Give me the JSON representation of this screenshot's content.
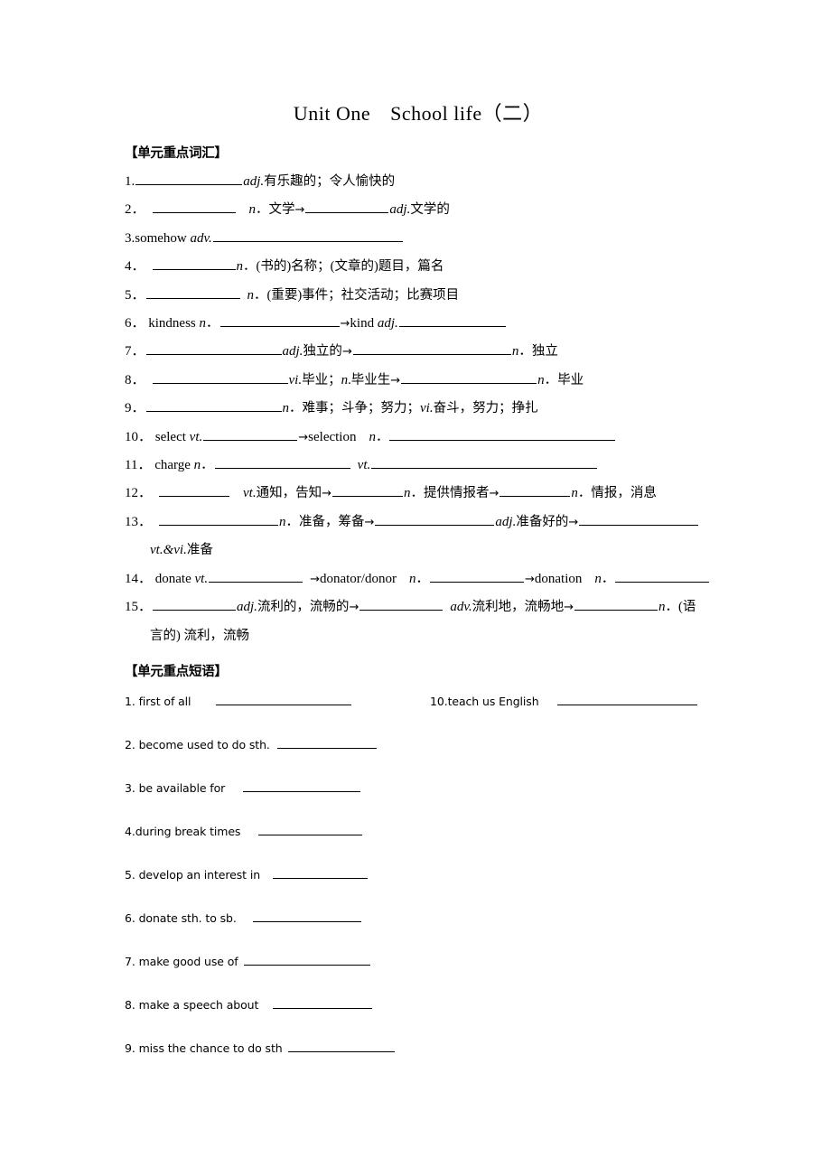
{
  "document": {
    "title_main": "Unit One",
    "title_sub": "School life",
    "title_paren": "（二）"
  },
  "vocab_section": {
    "heading": "【单元重点词汇】",
    "items": [
      {
        "num": "1.",
        "parts": [
          {
            "t": "blank",
            "w": "b-l"
          },
          {
            "t": "it",
            "v": "adj."
          },
          {
            "t": "cjk",
            "v": "有乐趣的；令人愉快的"
          }
        ]
      },
      {
        "num": "2．",
        "parts": [
          {
            "t": "gap",
            "v": "s"
          },
          {
            "t": "blank",
            "w": "b-m"
          },
          {
            "t": "gap",
            "v": "m"
          },
          {
            "t": "it",
            "v": "n"
          },
          {
            "t": "cjk",
            "v": "．文学"
          },
          {
            "t": "arrow",
            "v": "→"
          },
          {
            "t": "blank",
            "w": "b-m"
          },
          {
            "t": "it",
            "v": "adj."
          },
          {
            "t": "cjk",
            "v": "文学的"
          }
        ]
      },
      {
        "num": "3.somehow",
        "parts": [
          {
            "t": "sp"
          },
          {
            "t": "it",
            "v": "adv."
          },
          {
            "t": "blank",
            "w": "b-w2"
          }
        ]
      },
      {
        "num": "4．",
        "parts": [
          {
            "t": "gap",
            "v": "s"
          },
          {
            "t": "blank",
            "w": "b-m"
          },
          {
            "t": "it",
            "v": "n"
          },
          {
            "t": "cjk",
            "v": "．(书的)名称；(文章的)题目，篇名"
          }
        ]
      },
      {
        "num": "5．",
        "parts": [
          {
            "t": "blank",
            "w": "b-ml"
          },
          {
            "t": "gap",
            "v": "s"
          },
          {
            "t": "it",
            "v": "n"
          },
          {
            "t": "cjk",
            "v": "．(重要)事件；社交活动；比赛项目"
          }
        ]
      },
      {
        "num": "6．",
        "parts": [
          {
            "t": "sp"
          },
          {
            "t": "txt",
            "v": "kindness"
          },
          {
            "t": "sp"
          },
          {
            "t": "it",
            "v": "n"
          },
          {
            "t": "cjk",
            "v": "．"
          },
          {
            "t": "blank",
            "w": "b-xl"
          },
          {
            "t": "arrow",
            "v": "→"
          },
          {
            "t": "txt",
            "v": "kind"
          },
          {
            "t": "sp"
          },
          {
            "t": "it",
            "v": "adj."
          },
          {
            "t": "blank",
            "w": "b-l"
          }
        ]
      },
      {
        "num": "7．",
        "parts": [
          {
            "t": "blank",
            "w": "b-xxl"
          },
          {
            "t": "it",
            "v": "adj."
          },
          {
            "t": "cjk",
            "v": "独立的"
          },
          {
            "t": "arrow",
            "v": "→"
          },
          {
            "t": "blank",
            "w": "b-w1"
          },
          {
            "t": "it",
            "v": "n"
          },
          {
            "t": "cjk",
            "v": "．独立"
          }
        ]
      },
      {
        "num": "8．",
        "parts": [
          {
            "t": "gap",
            "v": "s"
          },
          {
            "t": "blank",
            "w": "b-xxl"
          },
          {
            "t": "it",
            "v": "vi."
          },
          {
            "t": "cjk",
            "v": "毕业；"
          },
          {
            "t": "it",
            "v": "n"
          },
          {
            "t": "cjk",
            "v": ".毕业生"
          },
          {
            "t": "arrow",
            "v": "→"
          },
          {
            "t": "blank",
            "w": "b-xxl"
          },
          {
            "t": "it",
            "v": "n"
          },
          {
            "t": "cjk",
            "v": "．毕业"
          }
        ]
      },
      {
        "num": "9．",
        "parts": [
          {
            "t": "blank",
            "w": "b-xxl"
          },
          {
            "t": "it",
            "v": "n"
          },
          {
            "t": "cjk",
            "v": "．难事；斗争；努力；"
          },
          {
            "t": "it",
            "v": "vi."
          },
          {
            "t": "cjk",
            "v": "奋斗，努力；挣扎"
          }
        ]
      },
      {
        "num": "10．",
        "parts": [
          {
            "t": "sp"
          },
          {
            "t": "txt",
            "v": "select"
          },
          {
            "t": "sp"
          },
          {
            "t": "it",
            "v": "vt."
          },
          {
            "t": "blank",
            "w": "b-ml"
          },
          {
            "t": "arrow",
            "v": "→"
          },
          {
            "t": "txt",
            "v": "selection"
          },
          {
            "t": "gap",
            "v": "m"
          },
          {
            "t": "it",
            "v": "n"
          },
          {
            "t": "cjk",
            "v": "．"
          },
          {
            "t": "blank",
            "w": "b-w3"
          }
        ]
      },
      {
        "num": "11．",
        "parts": [
          {
            "t": "sp"
          },
          {
            "t": "txt",
            "v": "charge"
          },
          {
            "t": "sp"
          },
          {
            "t": "it",
            "v": "n"
          },
          {
            "t": "cjk",
            "v": "．"
          },
          {
            "t": "blank",
            "w": "b-xxl"
          },
          {
            "t": "gap",
            "v": "s"
          },
          {
            "t": "it",
            "v": "vt."
          },
          {
            "t": "blank",
            "w": "b-w3"
          }
        ]
      },
      {
        "num": "12．",
        "parts": [
          {
            "t": "gap",
            "v": "s"
          },
          {
            "t": "blank",
            "w": "b-s"
          },
          {
            "t": "gap",
            "v": "m"
          },
          {
            "t": "it",
            "v": "vt."
          },
          {
            "t": "cjk",
            "v": "通知，告知"
          },
          {
            "t": "arrow",
            "v": "→"
          },
          {
            "t": "blank",
            "w": "b-s"
          },
          {
            "t": "it",
            "v": "n"
          },
          {
            "t": "cjk",
            "v": "．提供情报者"
          },
          {
            "t": "arrow",
            "v": "→"
          },
          {
            "t": "blank",
            "w": "b-s"
          },
          {
            "t": "it",
            "v": "n"
          },
          {
            "t": "cjk",
            "v": "．情报，消息"
          }
        ]
      },
      {
        "num": "13．",
        "parts": [
          {
            "t": "gap",
            "v": "s"
          },
          {
            "t": "blank",
            "w": "b-xl"
          },
          {
            "t": "it",
            "v": "n"
          },
          {
            "t": "cjk",
            "v": "．准备，筹备"
          },
          {
            "t": "arrow",
            "v": "→"
          },
          {
            "t": "blank",
            "w": "b-xl"
          },
          {
            "t": "it",
            "v": "adj."
          },
          {
            "t": "cjk",
            "v": "准备好的"
          },
          {
            "t": "arrow",
            "v": "→"
          },
          {
            "t": "blank",
            "w": "b-xl"
          }
        ],
        "cont": [
          {
            "t": "it",
            "v": "vt.&vi."
          },
          {
            "t": "cjk",
            "v": "准备"
          }
        ]
      },
      {
        "num": "14．",
        "parts": [
          {
            "t": "sp"
          },
          {
            "t": "txt",
            "v": "donate"
          },
          {
            "t": "sp"
          },
          {
            "t": "it",
            "v": "vt."
          },
          {
            "t": "blank",
            "w": "b-ml"
          },
          {
            "t": "gap",
            "v": "s"
          },
          {
            "t": "arrow",
            "v": "→"
          },
          {
            "t": "txt",
            "v": "donator/donor"
          },
          {
            "t": "gap",
            "v": "m"
          },
          {
            "t": "it",
            "v": "n"
          },
          {
            "t": "cjk",
            "v": "．"
          },
          {
            "t": "blank",
            "w": "b-ml"
          },
          {
            "t": "arrow",
            "v": "→"
          },
          {
            "t": "txt",
            "v": "donation"
          },
          {
            "t": "gap",
            "v": "m"
          },
          {
            "t": "it",
            "v": "n"
          },
          {
            "t": "cjk",
            "v": "．"
          },
          {
            "t": "blank",
            "w": "b-ml"
          }
        ]
      },
      {
        "num": "15．",
        "parts": [
          {
            "t": "blank",
            "w": "b-m"
          },
          {
            "t": "it",
            "v": "adj."
          },
          {
            "t": "cjk",
            "v": "流利的，流畅的"
          },
          {
            "t": "arrow",
            "v": "→"
          },
          {
            "t": "blank",
            "w": "b-m"
          },
          {
            "t": "gap",
            "v": "s"
          },
          {
            "t": "it",
            "v": "adv."
          },
          {
            "t": "cjk",
            "v": "流利地，流畅地"
          },
          {
            "t": "arrow",
            "v": "→"
          },
          {
            "t": "blank",
            "w": "b-m"
          },
          {
            "t": "it",
            "v": "n"
          },
          {
            "t": "cjk",
            "v": "．(语"
          }
        ],
        "cont": [
          {
            "t": "cjk",
            "v": "言的) 流利，流畅"
          }
        ]
      }
    ]
  },
  "phrase_section": {
    "heading": "【单元重点短语】",
    "left_items": [
      {
        "label": "1. first of all",
        "blank": "pb-a",
        "pre_gap": 22
      },
      {
        "label": "2. become used to do sth.",
        "blank": "pb-b",
        "pre_gap": 2
      },
      {
        "label": "3. be available for",
        "blank": "pb-c",
        "pre_gap": 14
      },
      {
        "label": "4.during break times",
        "blank": "pb-d",
        "pre_gap": 14
      },
      {
        "label": "5. develop an interest in",
        "blank": "pb-e",
        "pre_gap": 8
      },
      {
        "label": "6. donate sth. to sb.",
        "blank": "pb-f",
        "pre_gap": 12
      },
      {
        "label": "7. make good use of",
        "blank": "pb-g",
        "pre_gap": 0
      },
      {
        "label": "8. make a speech about",
        "blank": "pb-h",
        "pre_gap": 10
      },
      {
        "label": "9. miss the chance to do sth",
        "blank": "pb-i",
        "pre_gap": 0
      }
    ],
    "right_items": [
      {
        "label": "10.teach us English",
        "blank": "pb-j",
        "pre_gap": 14
      }
    ]
  }
}
